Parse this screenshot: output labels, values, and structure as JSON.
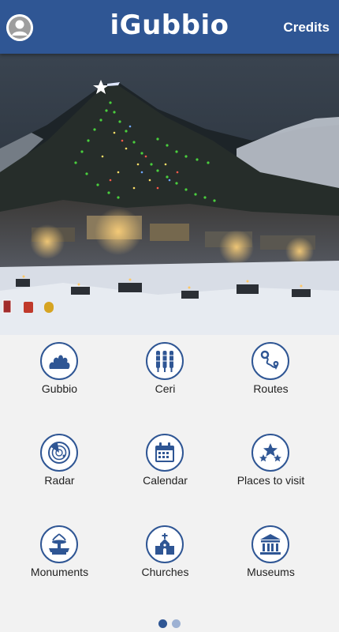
{
  "header": {
    "brand": "iGubbio",
    "credits_label": "Credits"
  },
  "menu": [
    {
      "label": "Gubbio",
      "icon": "tree-bush-icon"
    },
    {
      "label": "Ceri",
      "icon": "ceri-candles-icon"
    },
    {
      "label": "Routes",
      "icon": "route-pin-icon"
    },
    {
      "label": "Radar",
      "icon": "radar-icon"
    },
    {
      "label": "Calendar",
      "icon": "calendar-icon"
    },
    {
      "label": "Places to visit",
      "icon": "stars-icon"
    },
    {
      "label": "Monuments",
      "icon": "fountain-icon"
    },
    {
      "label": "Churches",
      "icon": "church-icon"
    },
    {
      "label": "Museums",
      "icon": "museum-icon"
    }
  ],
  "pager": {
    "current": 1,
    "total": 2
  },
  "colors": {
    "brand_blue": "#2f5694",
    "icon_blue": "#2f5694",
    "background": "#f2f2f2"
  }
}
